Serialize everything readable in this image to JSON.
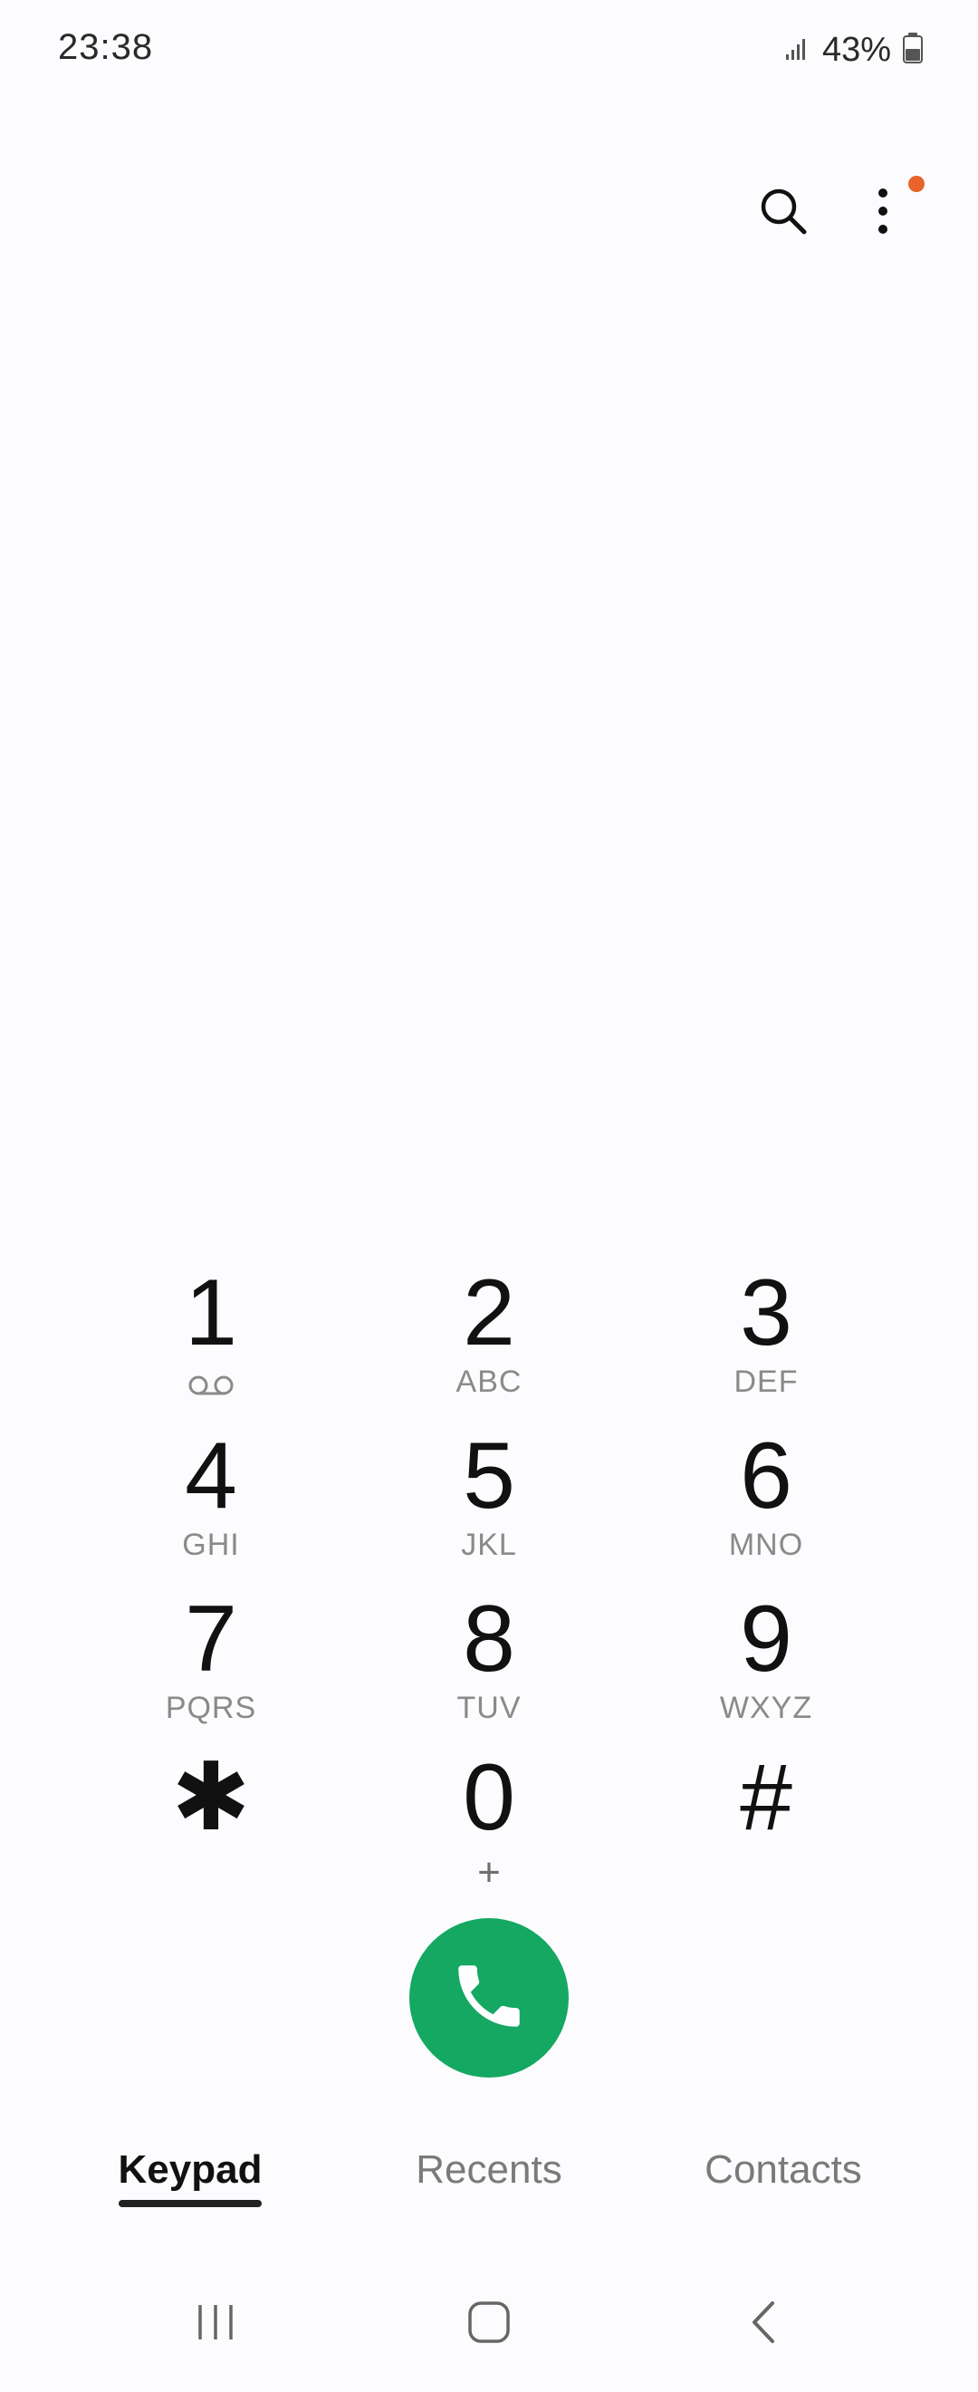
{
  "status_bar": {
    "time": "23:38",
    "battery": "43%",
    "icons": [
      "signal-icon",
      "battery-icon"
    ]
  },
  "top_actions": {
    "search_icon": "search-icon",
    "more_icon": "more-vert-icon",
    "notification_color": "#e8642a"
  },
  "keypad": {
    "keys": [
      {
        "digit": "1",
        "letters": "",
        "sub_icon": "voicemail-icon"
      },
      {
        "digit": "2",
        "letters": "ABC"
      },
      {
        "digit": "3",
        "letters": "DEF"
      },
      {
        "digit": "4",
        "letters": "GHI"
      },
      {
        "digit": "5",
        "letters": "JKL"
      },
      {
        "digit": "6",
        "letters": "MNO"
      },
      {
        "digit": "7",
        "letters": "PQRS"
      },
      {
        "digit": "8",
        "letters": "TUV"
      },
      {
        "digit": "9",
        "letters": "WXYZ"
      },
      {
        "digit": "✱",
        "letters": ""
      },
      {
        "digit": "0",
        "letters": "+"
      },
      {
        "digit": "#",
        "letters": ""
      }
    ]
  },
  "call_button": {
    "icon": "phone-icon",
    "color": "#14a862"
  },
  "tabs": [
    {
      "label": "Keypad",
      "active": true
    },
    {
      "label": "Recents",
      "active": false
    },
    {
      "label": "Contacts",
      "active": false
    }
  ],
  "nav_bar": {
    "icons": [
      "recent-apps-icon",
      "home-icon",
      "back-icon"
    ]
  }
}
